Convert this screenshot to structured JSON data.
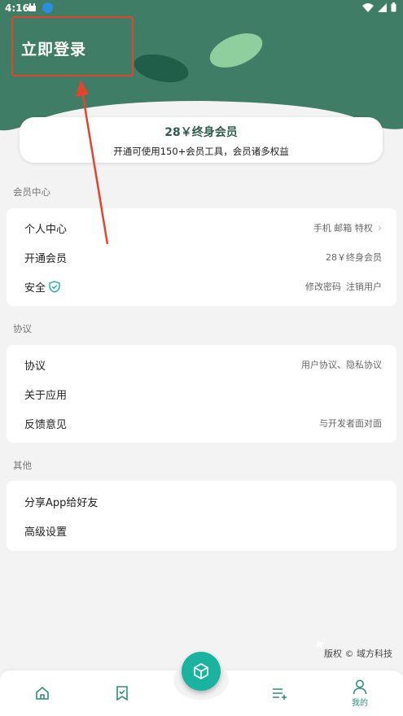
{
  "status_bar": {
    "time": "4:16"
  },
  "header": {
    "login_label": "立即登录"
  },
  "vip_card": {
    "title": "28￥终身会员",
    "subtitle": "开通可使用150+会员工具，会员诸多权益"
  },
  "sections": {
    "member": {
      "label": "会员中心",
      "rows": [
        {
          "label": "个人中心",
          "value": "手机 邮箱 特权"
        },
        {
          "label": "开通会员",
          "value": "28￥终身会员"
        },
        {
          "label": "安全",
          "value_a": "修改密码",
          "value_b": "注销用户"
        }
      ]
    },
    "agreement": {
      "label": "协议",
      "rows": [
        {
          "label": "协议",
          "value": "用户协议、隐私协议"
        },
        {
          "label": "关于应用",
          "value": ""
        },
        {
          "label": "反馈意见",
          "value": "与开发者面对面"
        }
      ]
    },
    "other": {
      "label": "其他",
      "rows": [
        {
          "label": "分享App给好友"
        },
        {
          "label": "高级设置"
        }
      ]
    }
  },
  "copyright": "版权 © 域方科技",
  "tabbar": {
    "mine_label": "我的"
  },
  "colors": {
    "header_green": "#3f7d67",
    "accent": "#19b3a0",
    "annotation_red": "#e2452c"
  }
}
